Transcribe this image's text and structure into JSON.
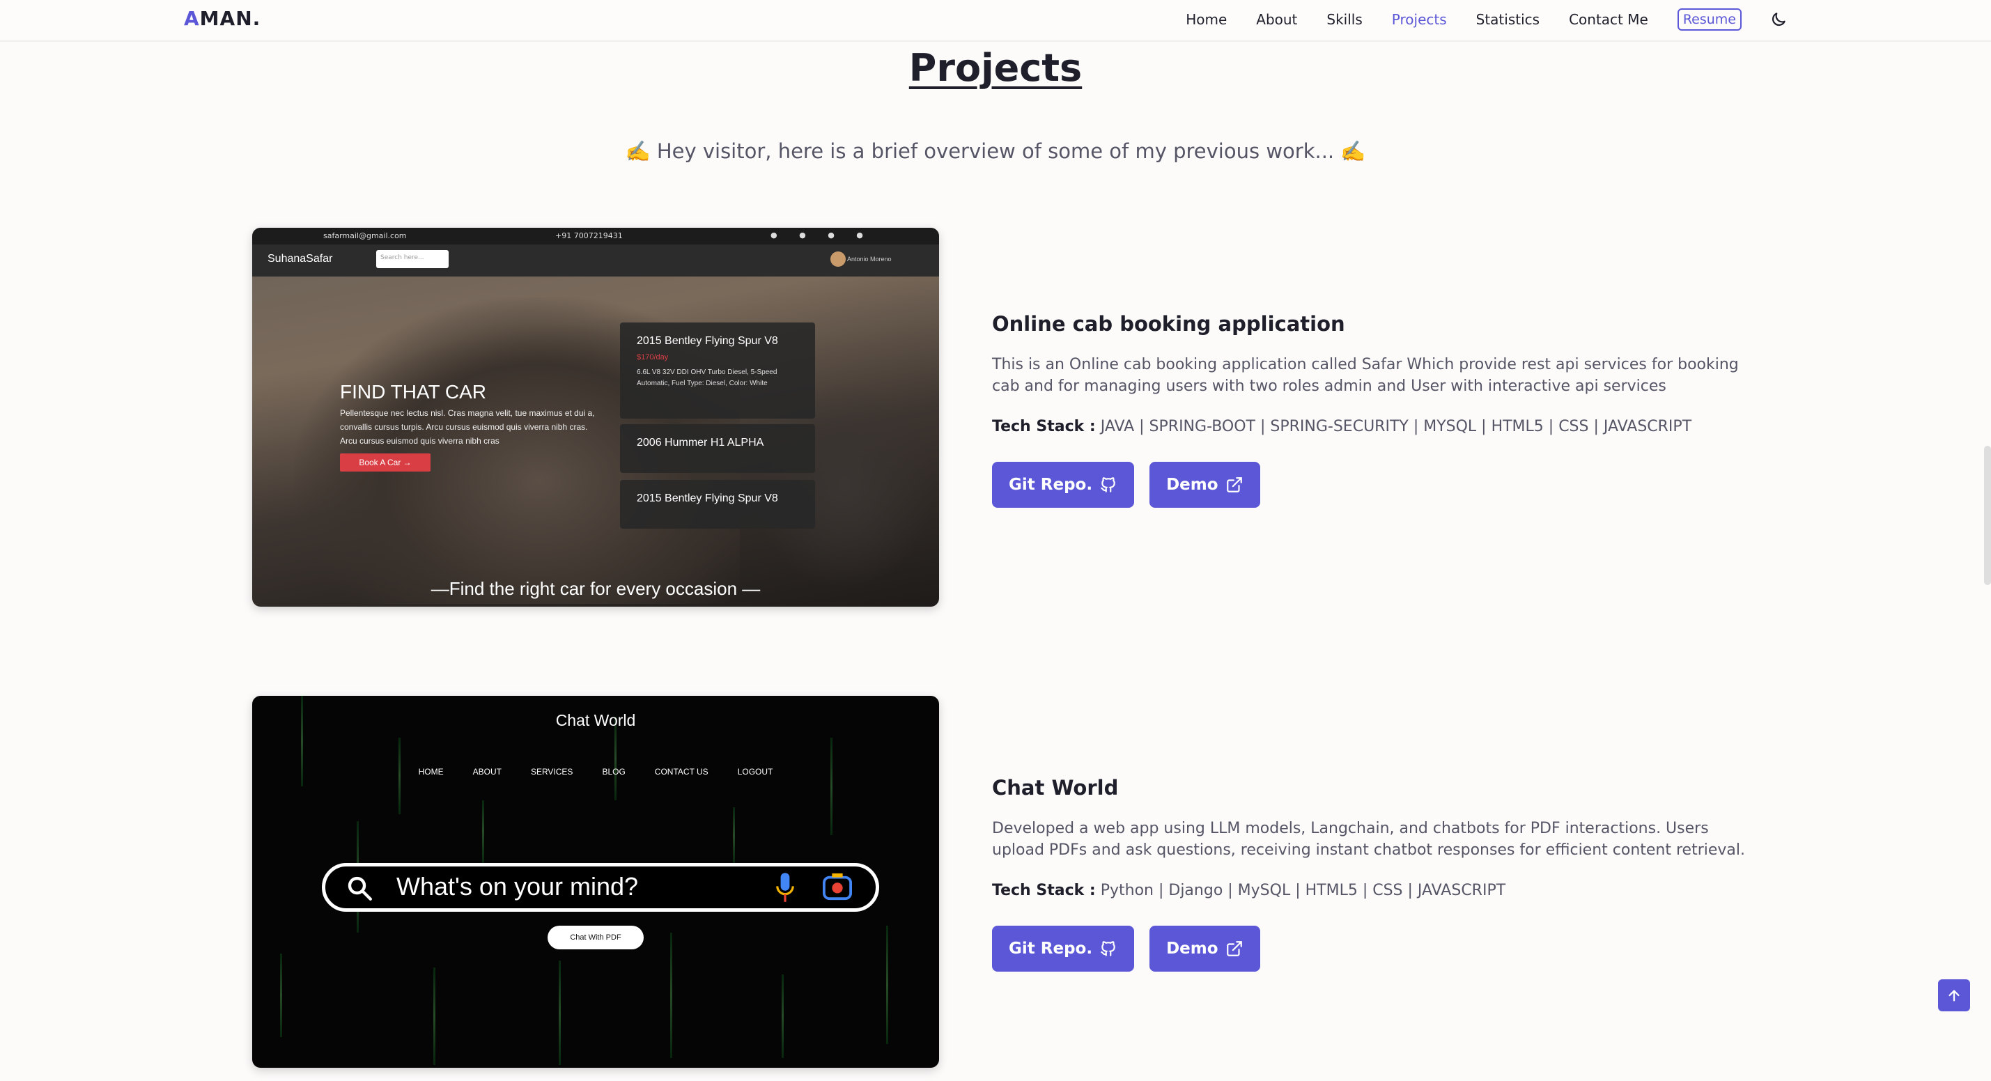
{
  "nav": {
    "logo_first": "A",
    "logo_rest": "MAN.",
    "links": [
      "Home",
      "About",
      "Skills",
      "Projects",
      "Statistics",
      "Contact Me"
    ],
    "active": "Projects",
    "resume": "Resume",
    "theme_icon": "moon-icon"
  },
  "header": {
    "title": "Projects",
    "subtitle": "✍️ Hey visitor, here is a brief overview of some of my previous work... ✍️"
  },
  "projects": [
    {
      "title": "Online cab booking application",
      "description": "This is an Online cab booking application called Safar Which provide rest api services for booking cab and for managing users with two roles admin and User with interactive api services",
      "tech_label": "Tech Stack :",
      "tech": "JAVA | SPRING-BOOT | SPRING-SECURITY | MYSQL | HTML5 | CSS | JAVASCRIPT",
      "git_label": "Git Repo.",
      "demo_label": "Demo",
      "screenshot": {
        "email": "safarmail@gmail.com",
        "phone": "+91 7007219431",
        "brand": "SuhanaSafar",
        "search_placeholder": "Search here...",
        "user": "Antonio Moreno",
        "heading": "FIND THAT CAR",
        "text": "Pellentesque nec lectus nisl. Cras magna velit, tue maximus et dui a, convallis cursus turpis. Arcu cursus euismod quis viverra nibh cras. Arcu cursus euismod quis viverra nibh cras",
        "book": "Book A Car →",
        "card1_name": "2015 Bentley Flying Spur V8",
        "card1_price": "$170/day",
        "card1_specs": "6.6L V8 32V DDI OHV Turbo Diesel, 5-Speed Automatic, Fuel Type: Diesel, Color: White",
        "card2_name": "2006 Hummer H1 ALPHA",
        "card3_name": "2015 Bentley Flying Spur V8",
        "caption": "—Find the right car for every occasion —"
      }
    },
    {
      "title": "Chat World",
      "description": "Developed a web app using LLM models, Langchain, and chatbots for PDF interactions. Users upload PDFs and ask questions, receiving instant chatbot responses for efficient content retrieval.",
      "tech_label": "Tech Stack :",
      "tech": "Python | Django | MySQL | HTML5 | CSS | JAVASCRIPT",
      "git_label": "Git Repo.",
      "demo_label": "Demo",
      "screenshot": {
        "title": "Chat World",
        "menu": [
          "HOME",
          "ABOUT",
          "SERVICES",
          "BLOG",
          "CONTACT US",
          "LOGOUT"
        ],
        "placeholder": "What's on your mind?",
        "pdf_button": "Chat With PDF"
      }
    }
  ],
  "colors": {
    "accent": "#5b57d6",
    "background": "#fcfbfa"
  }
}
